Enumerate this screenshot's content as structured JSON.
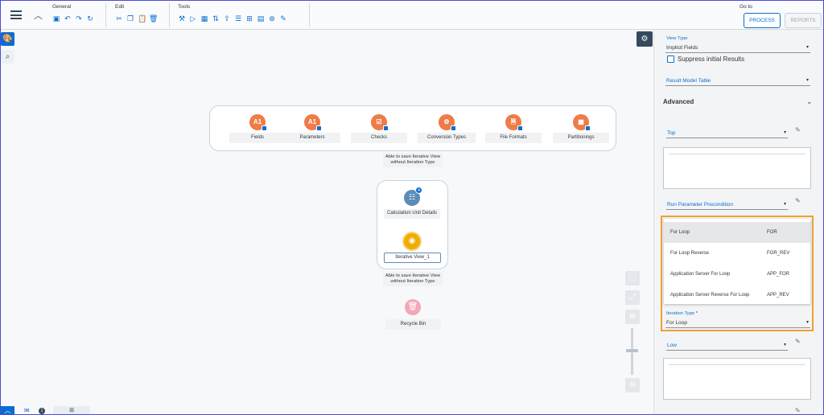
{
  "toolbar": {
    "groups": [
      {
        "label": "General",
        "icons": [
          "save-icon",
          "undo-icon",
          "redo-icon",
          "refresh-icon"
        ]
      },
      {
        "label": "Edit",
        "icons": [
          "cut-icon",
          "copy-icon",
          "paste-icon",
          "delete-icon"
        ]
      },
      {
        "label": "Tools",
        "icons": [
          "magic-wand-icon",
          "play-icon",
          "grid-icon",
          "sort-icon",
          "export-icon",
          "list-icon",
          "hierarchy-icon",
          "calendar-icon",
          "search-settings-icon",
          "brush-icon"
        ]
      }
    ],
    "goto_label": "Go to",
    "process_label": "PROCESS",
    "reports_label": "REPORTS"
  },
  "canvas": {
    "top_nodes": [
      {
        "label": "Fields",
        "glyph": "A1",
        "icon": "fields-icon"
      },
      {
        "label": "Parameters",
        "glyph": "A1",
        "icon": "parameters-icon"
      },
      {
        "label": "Checks",
        "glyph": "☑",
        "icon": "checks-icon"
      },
      {
        "label": "Conversion Types",
        "glyph": "⚙",
        "icon": "conversion-types-icon"
      },
      {
        "label": "File Formats",
        "glyph": "🗎",
        "icon": "file-formats-icon"
      },
      {
        "label": "Partitionings",
        "glyph": "▦",
        "icon": "partitionings-icon"
      }
    ],
    "note_top": "Able to save Iterative View without Iteration Type",
    "calc_badge": "4",
    "calc_label": "Calculation Unit Details",
    "iter_label": "Iterative View_1",
    "note_bottom": "Able to save Iterative View without Iteration Type",
    "bin_label": "Recycle Bin"
  },
  "bottom": {
    "message_count": "1"
  },
  "panel": {
    "view_type_label": "View Type",
    "view_type_value": "Implicit Fields",
    "suppress_label": "Suppress initial Results",
    "result_model_label": "Result Model Table",
    "advanced_label": "Advanced",
    "top_value": "Top",
    "run_param_value": "Run Parameter Precondition",
    "iteration_type_label": "Iteration Type",
    "iteration_type_required": "*",
    "iteration_type_value": "For Loop",
    "low_value": "Low",
    "dropdown_options": [
      {
        "name": "For Loop",
        "code": "FOR"
      },
      {
        "name": "For Loop Reverse",
        "code": "FOR_REV"
      },
      {
        "name": "Application Server For Loop",
        "code": "APP_FOR"
      },
      {
        "name": "Application Server Reverse For Loop",
        "code": "APP_REV"
      }
    ]
  },
  "colors": {
    "accent": "#0a6ed1",
    "node_orange": "#ef7b47",
    "highlight": "#f0a030",
    "shell": "#354a5f"
  }
}
